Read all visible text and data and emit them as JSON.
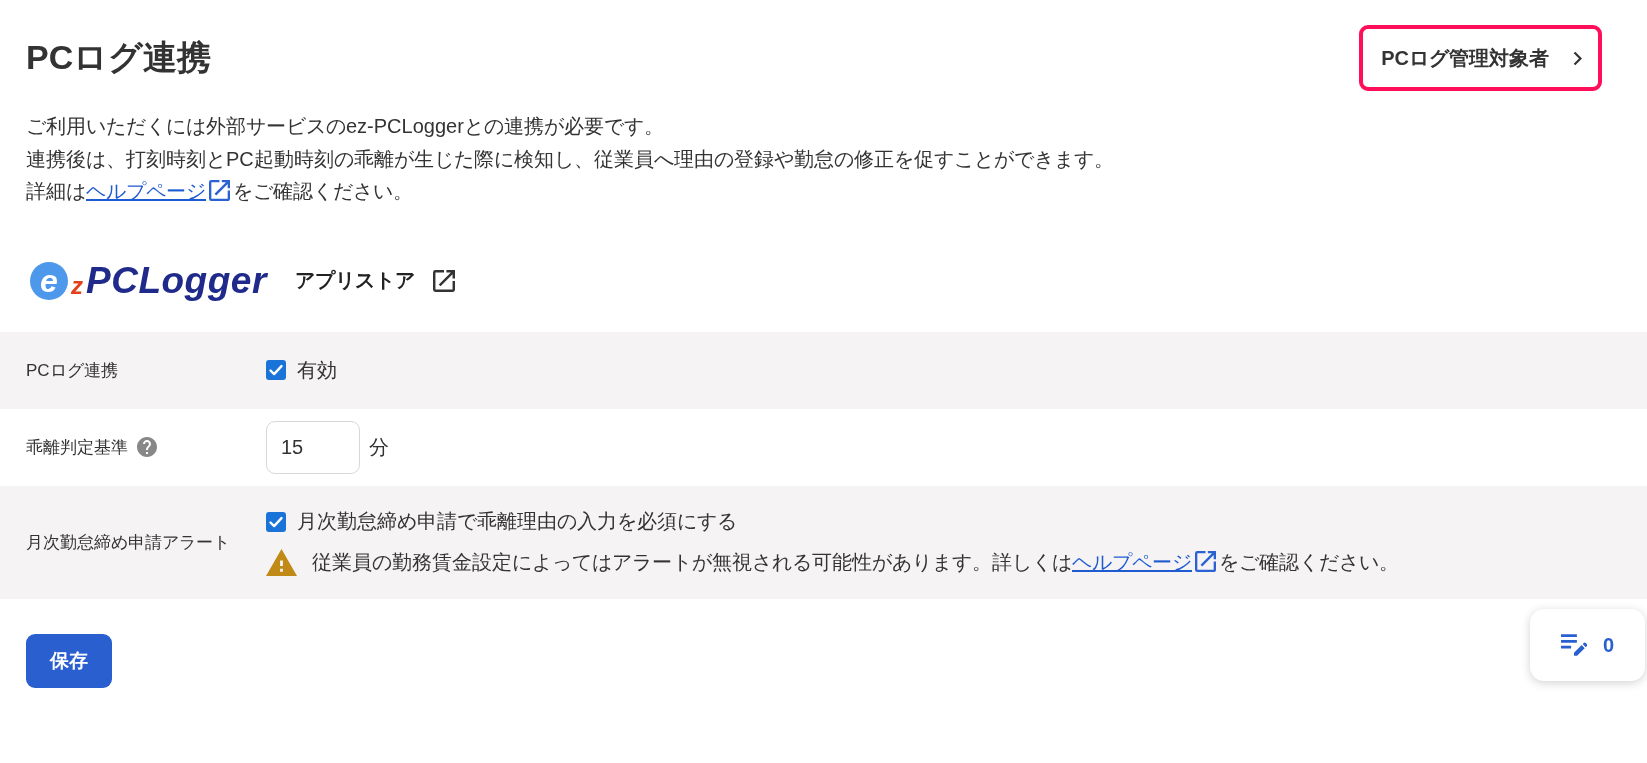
{
  "header": {
    "title": "PCログ連携",
    "target_button": {
      "label": "PCログ管理対象者"
    }
  },
  "description": {
    "lines": [
      "ご利用いただくには外部サービスのez-PCLoggerとの連携が必要です。",
      "連携後は、打刻時刻とPC起動時刻の乖離が生じた際に検知し、従業員へ理由の登録や勤怠の修正を促すことができます。"
    ],
    "help": {
      "before": "詳細は",
      "link": "ヘルプページ",
      "after": "をご確認ください。"
    }
  },
  "integration": {
    "logo": {
      "badge_letter": "e",
      "accent_letter": "z",
      "wordmark": "PCLogger"
    },
    "store_link": {
      "label": "アプリストア"
    }
  },
  "settings": [
    {
      "kind": "checkbox",
      "label": "PCログ連携",
      "help": false,
      "option": {
        "label": "有効",
        "checked": true
      }
    },
    {
      "kind": "number",
      "label": "乖離判定基準",
      "help": true,
      "value": "15",
      "unit": "分"
    },
    {
      "kind": "alert",
      "label": "月次勤怠締め申請アラート",
      "help": false,
      "option": {
        "label": "月次勤怠締め申請で乖離理由の入力を必須にする",
        "checked": true
      },
      "warning": {
        "before": "従業員の勤務賃金設定によってはアラートが無視される可能性があります。詳しくは",
        "link": "ヘルプページ",
        "after": "をご確認ください。"
      }
    }
  ],
  "save_button": {
    "label": "保存"
  },
  "floating_button": {
    "count": "0"
  }
}
